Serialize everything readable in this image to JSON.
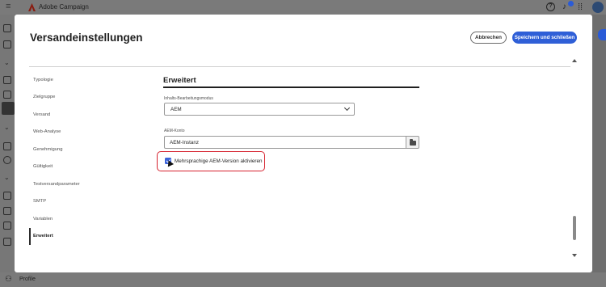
{
  "app": {
    "name": "Adobe Campaign",
    "notification_count": ""
  },
  "footer": {
    "label": "Profile"
  },
  "dialog": {
    "title": "Versandeinstellungen",
    "cancel_label": "Abbrechen",
    "save_label": "Speichern und schließen"
  },
  "nav": {
    "items": [
      {
        "label": "Typologie"
      },
      {
        "label": "Zielgruppe"
      },
      {
        "label": "Versand"
      },
      {
        "label": "Web-Analyse"
      },
      {
        "label": "Genehmigung"
      },
      {
        "label": "Gültigkeit"
      },
      {
        "label": "Testversandparameter"
      },
      {
        "label": "SMTP"
      },
      {
        "label": "Variablen"
      },
      {
        "label": "Erweitert"
      }
    ],
    "active": "Erweitert"
  },
  "section": {
    "title": "Erweitert",
    "content_mode_label": "Inhalts-Bearbeitungsmodus",
    "content_mode_value": "AEM",
    "aem_account_label": "AEM-Konto",
    "aem_account_value": "AEM-Instanz",
    "multilang_label": "Mehrsprachige AEM-Version aktivieren",
    "multilang_checked": true
  },
  "colors": {
    "accent": "#2f5fd7",
    "highlight": "#d6222e"
  }
}
